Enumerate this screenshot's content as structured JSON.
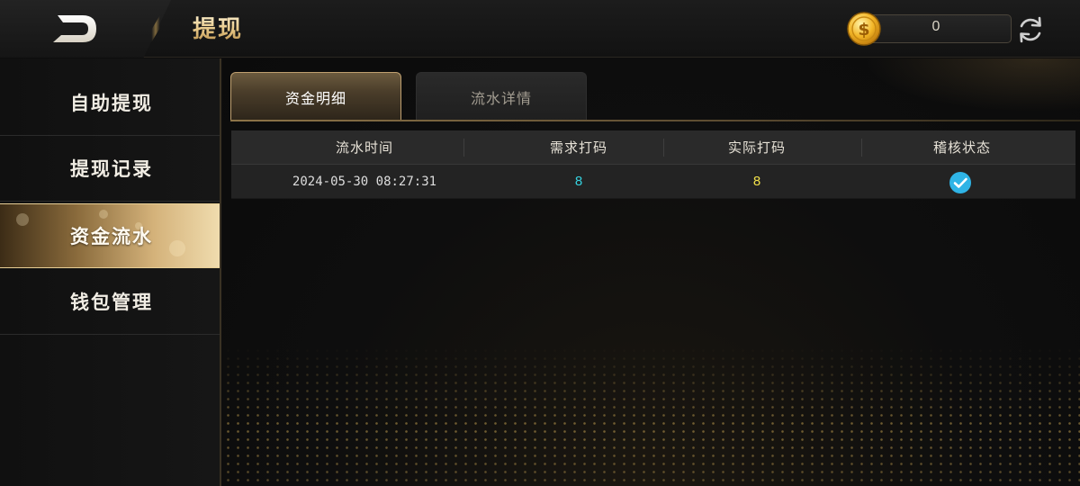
{
  "header": {
    "title": "提现",
    "coin_balance": "0"
  },
  "sidebar": {
    "items": [
      {
        "label": "自助提现",
        "active": false
      },
      {
        "label": "提现记录",
        "active": false
      },
      {
        "label": "资金流水",
        "active": true
      },
      {
        "label": "钱包管理",
        "active": false
      }
    ]
  },
  "tabs": [
    {
      "label": "资金明细",
      "active": true
    },
    {
      "label": "流水详情",
      "active": false
    }
  ],
  "table": {
    "columns": [
      "流水时间",
      "需求打码",
      "实际打码",
      "稽核状态"
    ],
    "rows": [
      {
        "time": "2024-05-30  08:27:31",
        "required": "8",
        "actual": "8",
        "status": "passed"
      }
    ]
  },
  "colors": {
    "accent_gold": "#d4b27a",
    "required_value": "#35d3e0",
    "actual_value": "#f2e14a",
    "status_check": "#2fb4e6"
  },
  "icons": {
    "back": "back-arrow-icon",
    "coin": "gold-coin-icon",
    "refresh": "refresh-icon",
    "status": "check-circle-icon"
  }
}
